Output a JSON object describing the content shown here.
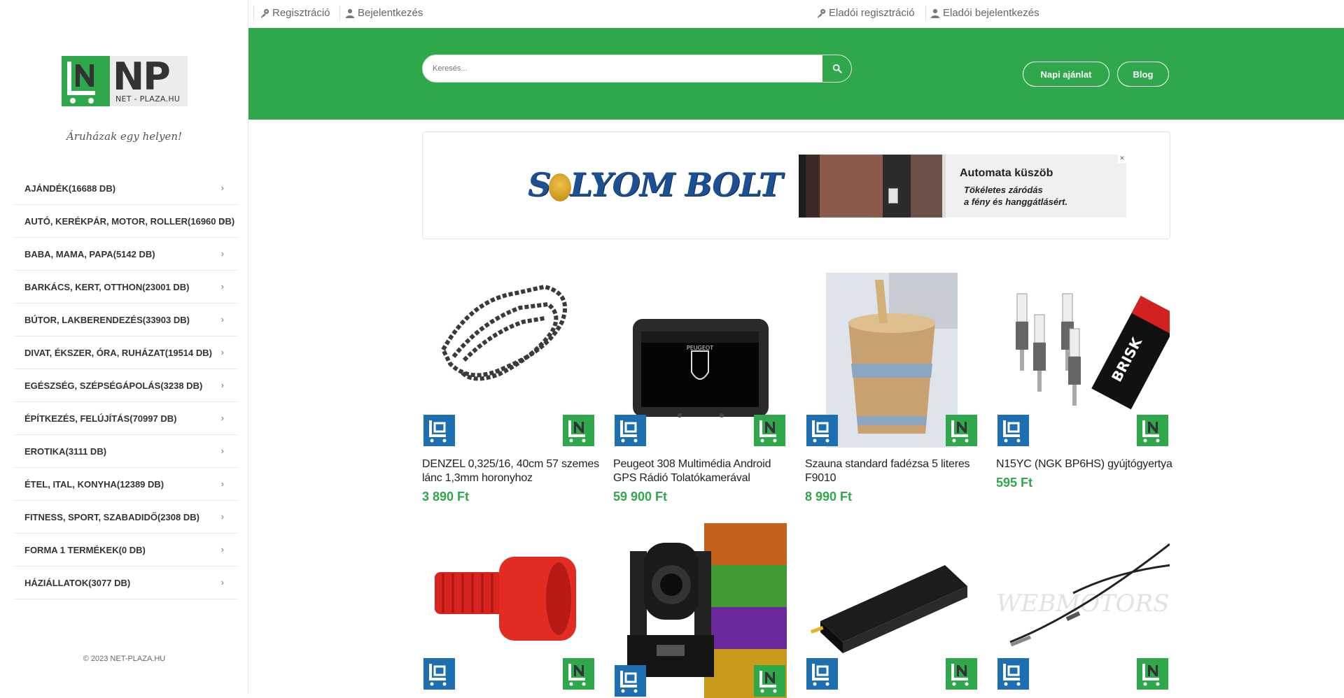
{
  "sidebar": {
    "logo": {
      "text": "NET - PLAZA.HU",
      "letters": "NP"
    },
    "tagline": "Áruházak egy helyen!",
    "categories": [
      {
        "label": "AJÁNDÉK(16688 DB)"
      },
      {
        "label": "AUTÓ, KERÉKPÁR, MOTOR, ROLLER(16960 DB)"
      },
      {
        "label": "BABA, MAMA, PAPA(5142 DB)"
      },
      {
        "label": "BARKÁCS, KERT, OTTHON(23001 DB)"
      },
      {
        "label": "BÚTOR, LAKBERENDEZÉS(33903 DB)"
      },
      {
        "label": "DIVAT, ÉKSZER, ÓRA, RUHÁZAT(19514 DB)"
      },
      {
        "label": "EGÉSZSÉG, SZÉPSÉGÁPOLÁS(3238 DB)"
      },
      {
        "label": "ÉPÍTKEZÉS, FELÚJÍTÁS(70997 DB)"
      },
      {
        "label": "EROTIKA(3111 DB)"
      },
      {
        "label": "ÉTEL, ITAL, KONYHA(12389 DB)"
      },
      {
        "label": "FITNESS, SPORT, SZABADIDŐ(2308 DB)"
      },
      {
        "label": "FORMA 1 TERMÉKEK(0 DB)"
      },
      {
        "label": "HÁZIÁLLATOK(3077 DB)"
      }
    ],
    "chevron": "›",
    "copyright": "© 2023 NET-PLAZA.HU"
  },
  "topbar": {
    "register": "Regisztráció",
    "login": "Bejelentkezés",
    "seller_register": "Eladói regisztráció",
    "seller_login": "Eladói bejelentkezés"
  },
  "header": {
    "search_placeholder": "Keresés...",
    "daily_offer": "Napi ajánlat",
    "blog": "Blog"
  },
  "banner": {
    "brand_left": "S",
    "brand_right": "LYOM BOLT",
    "ad_title": "Automata küszöb",
    "ad_subtitle_1": "Tökéletes záródás",
    "ad_subtitle_2": "a fény és hanggátlásért.",
    "ad_close": "✕"
  },
  "products": [
    {
      "name": "DENZEL 0,325/16, 40cm 57 szemes lánc 1,3mm horonyhoz",
      "price": "3 890 Ft"
    },
    {
      "name": "Peugeot 308 Multimédia Android GPS Rádió Tolatókamerával",
      "price": "59 900 Ft",
      "screen_text": "PEUGEOT"
    },
    {
      "name": "Szauna standard fadézsa 5 literes F9010",
      "price": "8 990 Ft"
    },
    {
      "name": "N15YC (NGK BP6HS) gyújtógyertya",
      "price": "595 Ft",
      "box_text": "BRISK"
    },
    {
      "name": "",
      "price": ""
    },
    {
      "name": "",
      "price": ""
    },
    {
      "name": "",
      "price": ""
    },
    {
      "name": "",
      "price": "",
      "watermark": "WEBMOTORS"
    }
  ],
  "colors": {
    "brand_green": "#2ea84b",
    "brand_blue": "#1d6fb1",
    "price_green": "#2ea84b"
  }
}
